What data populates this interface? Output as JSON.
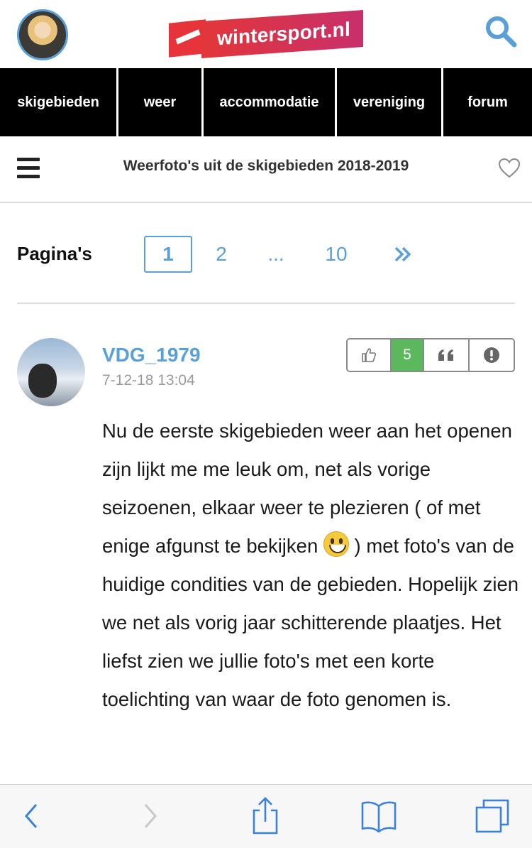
{
  "header": {
    "logo_text": "wintersport.nl",
    "icons": {
      "search": "search-icon",
      "avatar": "user-avatar"
    }
  },
  "nav": {
    "items": [
      {
        "label": "skigebieden"
      },
      {
        "label": "weer"
      },
      {
        "label": "accommodatie"
      },
      {
        "label": "vereniging"
      },
      {
        "label": "forum"
      }
    ]
  },
  "thread": {
    "title": "Weerfoto's uit de skigebieden 2018-2019",
    "icons": {
      "menu": "hamburger-icon",
      "favorite": "heart-icon"
    }
  },
  "pagination": {
    "label": "Pagina's",
    "pages": [
      "1",
      "2",
      "...",
      "10"
    ],
    "current": "1",
    "next_icon": "double-chevron-right-icon"
  },
  "post": {
    "username": "VDG_1979",
    "date": "7-12-18 13:04",
    "like_count": "5",
    "action_icons": [
      "thumbs-up-icon",
      "quote-icon",
      "report-icon"
    ],
    "body_part1": "Nu de eerste skigebieden weer aan het openen zijn lijkt me me leuk om, net als vorige seizoenen, elkaar weer te plezieren ( of met enige afgunst te bekijken ",
    "body_part2": " ) met foto's van de huidige condities van de gebieden. Hopelijk zien we net als vorig jaar schitterende plaatjes. Het liefst zien we jullie foto's met een korte toelichting van waar de foto genomen is.",
    "emoji": "smiley-emoji"
  },
  "browser_toolbar": {
    "icons": [
      "back-icon",
      "forward-icon",
      "share-icon",
      "bookmarks-icon",
      "tabs-icon"
    ]
  },
  "colors": {
    "accent": "#5aa0d8",
    "brand_red": "#e6343a",
    "like_green": "#5cb85c",
    "nav_bg": "#000000"
  }
}
